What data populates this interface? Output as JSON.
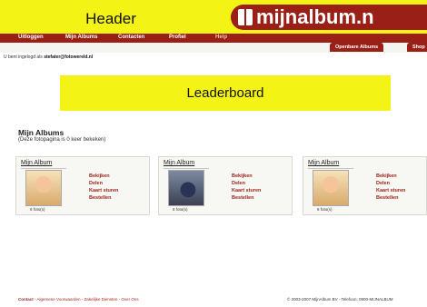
{
  "header": {
    "label": "Header",
    "logo_text": "mijnalbum.n"
  },
  "nav": {
    "items": [
      "Uitloggen",
      "Mijn Albums",
      "Contacten",
      "Profiel",
      "Help"
    ]
  },
  "subnav": {
    "tabs": [
      "Openbare Albums",
      "Shop"
    ]
  },
  "session": {
    "prefix": "U bent ingelogd als",
    "user": "stefater@fotowereld.nl"
  },
  "leaderboard": {
    "label": "Leaderboard"
  },
  "main": {
    "title": "Mijn Albums",
    "subtitle": "(Deze fotopagina is 0 keer bekeken)",
    "albums": [
      {
        "title": "Mijn Album",
        "count": "6 foto(s)",
        "photo": "child-photo",
        "actions": [
          "Bekijken",
          "Delen",
          "Kaart sturen",
          "Bestellen"
        ]
      },
      {
        "title": "Mijn Album",
        "count": "6 foto(s)",
        "photo": "motorcycle-photo",
        "actions": [
          "Bekijken",
          "Delen",
          "Kaart sturen",
          "Bestellen"
        ]
      },
      {
        "title": "Mijn Album",
        "count": "6 foto(s)",
        "photo": "child-photo",
        "actions": [
          "Bekijken",
          "Delen",
          "Kaart sturen",
          "Bestellen"
        ]
      }
    ]
  },
  "footer": {
    "links": [
      "Contact",
      "Algemene Voorwaarden",
      "Zakelijke Diensten",
      "Over Ons"
    ],
    "separator": " - ",
    "copyright": "© 2003-2007 MijnAlbum BV - Telefoon: 0900-MIJNALBUM"
  },
  "colors": {
    "accent": "#9a1f16",
    "placeholder": "#f3f315"
  }
}
